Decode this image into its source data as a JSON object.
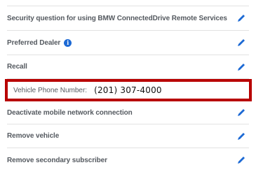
{
  "settings": {
    "items": [
      {
        "label": "Security question for using BMW ConnectedDrive Remote Services",
        "edit_icon": "pencil-icon"
      },
      {
        "label": "Preferred Dealer",
        "info_icon": "info-icon",
        "info_glyph": "i",
        "edit_icon": "pencil-icon"
      },
      {
        "label": "Recall",
        "edit_icon": "pencil-icon"
      },
      {
        "label": "Deactivate mobile network connection",
        "edit_icon": "pencil-icon"
      },
      {
        "label": "Remove vehicle",
        "edit_icon": "pencil-icon"
      },
      {
        "label": "Remove secondary subscriber",
        "edit_icon": "pencil-icon"
      }
    ]
  },
  "vehicle_phone": {
    "label": "Vehicle Phone Number:",
    "value": "(201) 307-4000"
  },
  "colors": {
    "accent": "#1c69d4",
    "highlight_border": "#b80000",
    "label_text": "#555a60",
    "divider": "#e2e2e2"
  }
}
